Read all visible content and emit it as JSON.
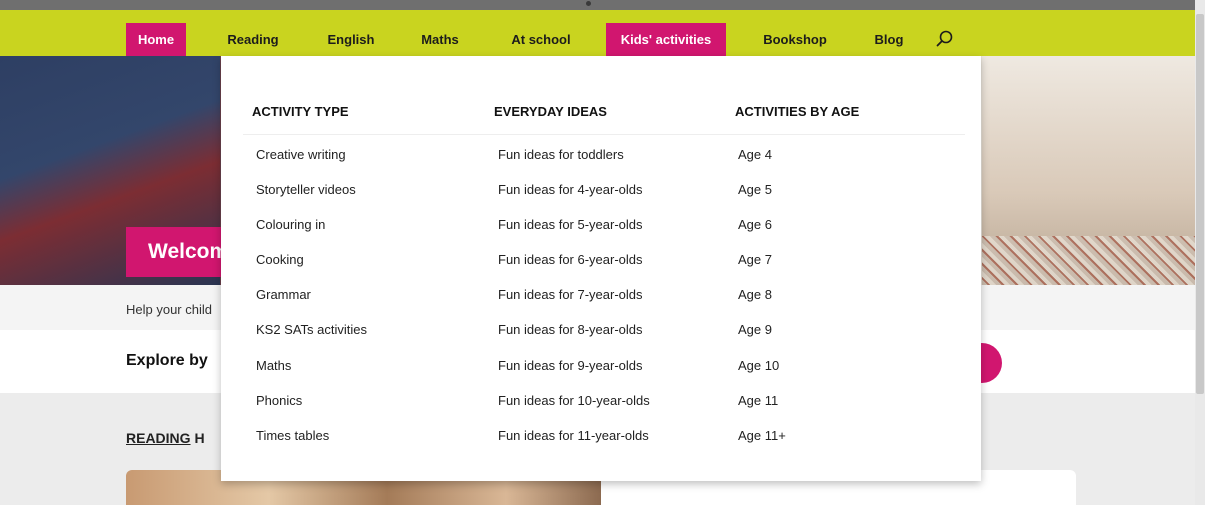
{
  "nav": {
    "items": [
      {
        "label": "Home",
        "active": true
      },
      {
        "label": "Reading",
        "active": false
      },
      {
        "label": "English",
        "active": false
      },
      {
        "label": "Maths",
        "active": false
      },
      {
        "label": "At school",
        "active": false
      },
      {
        "label": "Kids' activities",
        "active": true
      },
      {
        "label": "Bookshop",
        "active": false
      },
      {
        "label": "Blog",
        "active": false
      }
    ],
    "search_icon": "search-icon"
  },
  "hero": {
    "welcome": "Welcome"
  },
  "intro": {
    "text": "Help your child"
  },
  "explore": {
    "text": "Explore by"
  },
  "section": {
    "link": "READING",
    "rest": " H"
  },
  "dropdown": {
    "columns": [
      {
        "heading": "ACTIVITY TYPE",
        "items": [
          "Creative writing",
          "Storyteller videos",
          "Colouring in",
          "Cooking",
          "Grammar",
          "KS2 SATs activities",
          "Maths",
          "Phonics",
          "Times tables"
        ]
      },
      {
        "heading": "EVERYDAY IDEAS",
        "items": [
          "Fun ideas for toddlers",
          "Fun ideas for 4-year-olds",
          "Fun ideas for 5-year-olds",
          "Fun ideas for 6-year-olds",
          "Fun ideas for 7-year-olds",
          "Fun ideas for 8-year-olds",
          "Fun ideas for 9-year-olds",
          "Fun ideas for 10-year-olds",
          "Fun ideas for 11-year-olds"
        ]
      },
      {
        "heading": "ACTIVITIES BY AGE",
        "items": [
          "Age 4",
          "Age 5",
          "Age 6",
          "Age 7",
          "Age 8",
          "Age 9",
          "Age 10",
          "Age 11",
          "Age 11+"
        ]
      }
    ]
  },
  "colors": {
    "accent": "#d1166f",
    "nav_bg": "#c9d41f"
  }
}
